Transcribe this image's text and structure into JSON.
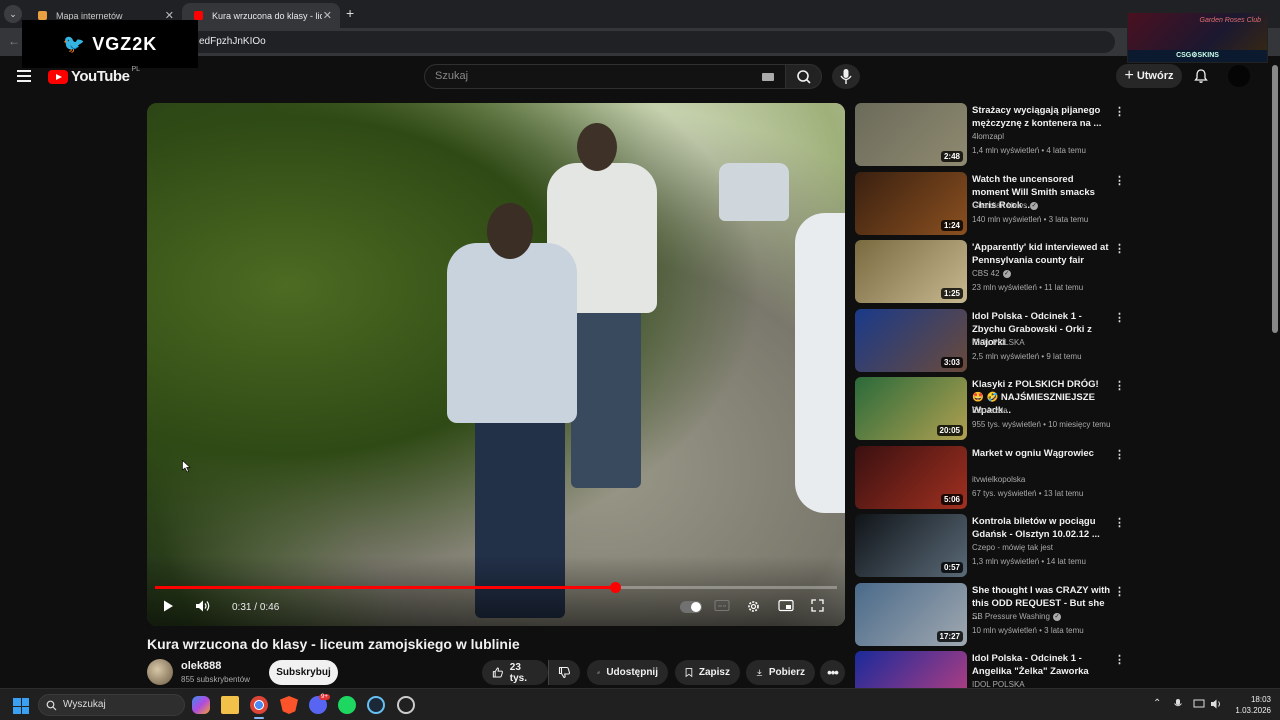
{
  "browser": {
    "tabs": [
      {
        "label": "Mapa internetów",
        "active": false
      },
      {
        "label": "Kura wrzucona do klasy - liceum",
        "active": true
      }
    ],
    "new_tab": "+",
    "address": "edFpzhJnKIOo"
  },
  "overlay": {
    "logo_text": "VGZ2K",
    "stream_label": "CSG⚙SKINS",
    "stream_sign": "Garden Roses Club"
  },
  "header": {
    "logo_text": "YouTube",
    "country": "PL",
    "search_placeholder": "Szukaj",
    "create_label": "Utwórz"
  },
  "player": {
    "time_current": "0:31",
    "time_total": "0:46",
    "time_sep": " / ",
    "progress_fraction": 0.674
  },
  "video": {
    "title": "Kura wrzucona do klasy - liceum zamojskiego w lublinie",
    "channel": "olek888",
    "subscribers": "855 subskrybentów",
    "subscribe_label": "Subskrybuj",
    "likes": "23 tys.",
    "share_label": "Udostępnij",
    "save_label": "Zapisz",
    "download_label": "Pobierz"
  },
  "recommendations": [
    {
      "title": "Strażacy wyciągają pijanego mężczyznę z kontenera na ...",
      "channel": "4lomzapl",
      "verified": false,
      "meta": "1,4 mln wyświetleń • 4 lata temu",
      "duration": "2:48",
      "colors": [
        "#6b6b5a",
        "#8f8a70"
      ]
    },
    {
      "title": "Watch the uncensored moment Will Smith smacks Chris Rock ...",
      "channel": "Guardian News",
      "verified": true,
      "meta": "140 mln wyświetleń • 3 lata temu",
      "duration": "1:24",
      "colors": [
        "#3a2010",
        "#8a5020"
      ]
    },
    {
      "title": "'Apparently' kid interviewed at Pennsylvania county fair",
      "channel": "CBS 42",
      "verified": true,
      "meta": "23 mln wyświetleń • 11 lat temu",
      "duration": "1:25",
      "colors": [
        "#7a6a40",
        "#c8b890"
      ]
    },
    {
      "title": "Idol Polska - Odcinek 1 - Zbychu Grabowski - Orki z Majorki",
      "channel": "IDOL POLSKA",
      "verified": false,
      "meta": "2,5 mln wyświetleń • 9 lat temu",
      "duration": "3:03",
      "colors": [
        "#1a3a8a",
        "#6a4a3a"
      ]
    },
    {
      "title": "Klasyki z POLSKICH DRÓG! 🤩 🤣 NAJŚMIESZNIEJSZE Wpadk...",
      "channel": "EduJazda",
      "verified": false,
      "meta": "955 tys. wyświetleń • 10 miesięcy temu",
      "duration": "20:05",
      "colors": [
        "#2a6a3a",
        "#b0a050"
      ]
    },
    {
      "title": "Market w ogniu Wągrowiec",
      "channel": "itvwielkopolska",
      "verified": false,
      "meta": "67 tys. wyświetleń • 13 lat temu",
      "duration": "5:06",
      "colors": [
        "#3a1010",
        "#a03020"
      ]
    },
    {
      "title": "Kontrola biletów w pociągu Gdańsk - Olsztyn 10.02.12 ...",
      "channel": "Czepo - mówię tak jest",
      "verified": false,
      "meta": "1,3 mln wyświetleń • 14 lat temu",
      "duration": "0:57",
      "colors": [
        "#101418",
        "#5a6a78"
      ]
    },
    {
      "title": "She thought I was CRAZY with this ODD REQUEST - But she ...",
      "channel": "SB Pressure Washing",
      "verified": true,
      "meta": "10 mln wyświetleń • 3 lata temu",
      "duration": "17:27",
      "colors": [
        "#4a6a8a",
        "#a0a8b0"
      ]
    },
    {
      "title": "Idol Polska - Odcinek 1 - Angelika \"Żelka\" Zaworka",
      "channel": "IDOL POLSKA",
      "verified": false,
      "meta": "",
      "duration": "",
      "colors": [
        "#1a2a9a",
        "#c04080"
      ]
    }
  ],
  "taskbar": {
    "search_label": "Wyszukaj",
    "time": "18:03",
    "date": "1.03.2026",
    "discord_badge": "9+"
  }
}
